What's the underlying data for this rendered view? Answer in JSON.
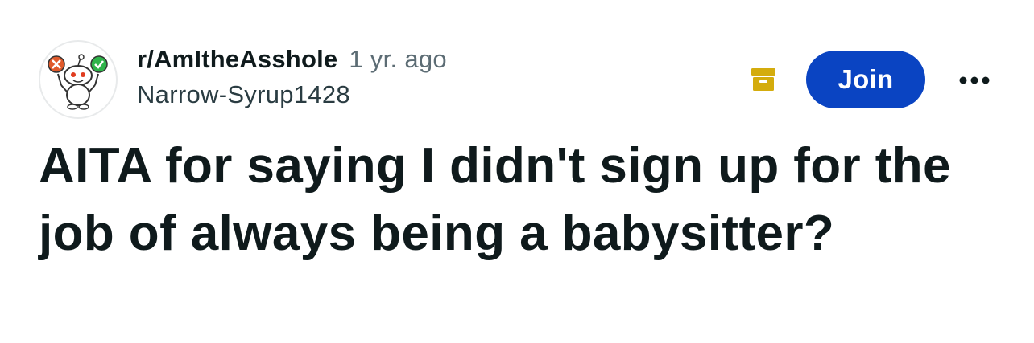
{
  "post": {
    "subreddit": "r/AmItheAsshole",
    "age": "1 yr. ago",
    "author": "Narrow-Syrup1428",
    "title": "AITA for saying I didn't sign up for the job of always being a babysitter?"
  },
  "actions": {
    "join_label": "Join",
    "archive_icon": "archive-box-icon",
    "more_icon": "more-options-icon"
  },
  "colors": {
    "join_button": "#0a44c2",
    "archive_icon": "#d4ac0d",
    "text_primary": "#0f1a1c",
    "text_secondary": "#5c6c74"
  }
}
